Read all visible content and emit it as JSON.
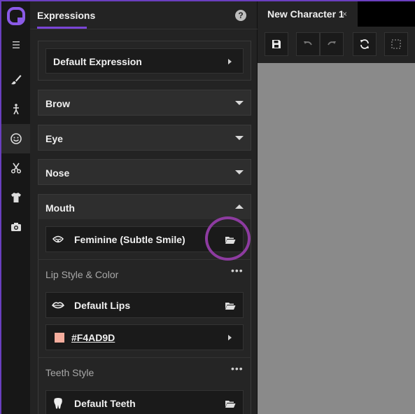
{
  "panel": {
    "title": "Expressions",
    "help_label": "?",
    "default_expression": "Default Expression"
  },
  "sections": {
    "brow": "Brow",
    "eye": "Eye",
    "nose": "Nose",
    "mouth": "Mouth"
  },
  "mouth": {
    "preset": "Feminine (Subtle Smile)",
    "lip_section_label": "Lip Style & Color",
    "lip_style": "Default Lips",
    "lip_color": "#F4AD9D",
    "teeth_section_label": "Teeth Style",
    "teeth_style": "Default Teeth",
    "more_label": "•••"
  },
  "tab": {
    "label": "New Character 1",
    "close_label": "×"
  },
  "colors": {
    "accent": "#7a45d6",
    "highlight": "#8d3ba0",
    "lip_swatch": "#F4AD9D"
  },
  "icons": {
    "logo": "app-logo-icon",
    "menu": "hamburger-menu-icon",
    "brush": "brush-icon",
    "pose": "figure-icon",
    "expression": "smiley-icon",
    "cut": "scissors-icon",
    "outfit": "shirt-icon",
    "camera": "camera-icon"
  }
}
